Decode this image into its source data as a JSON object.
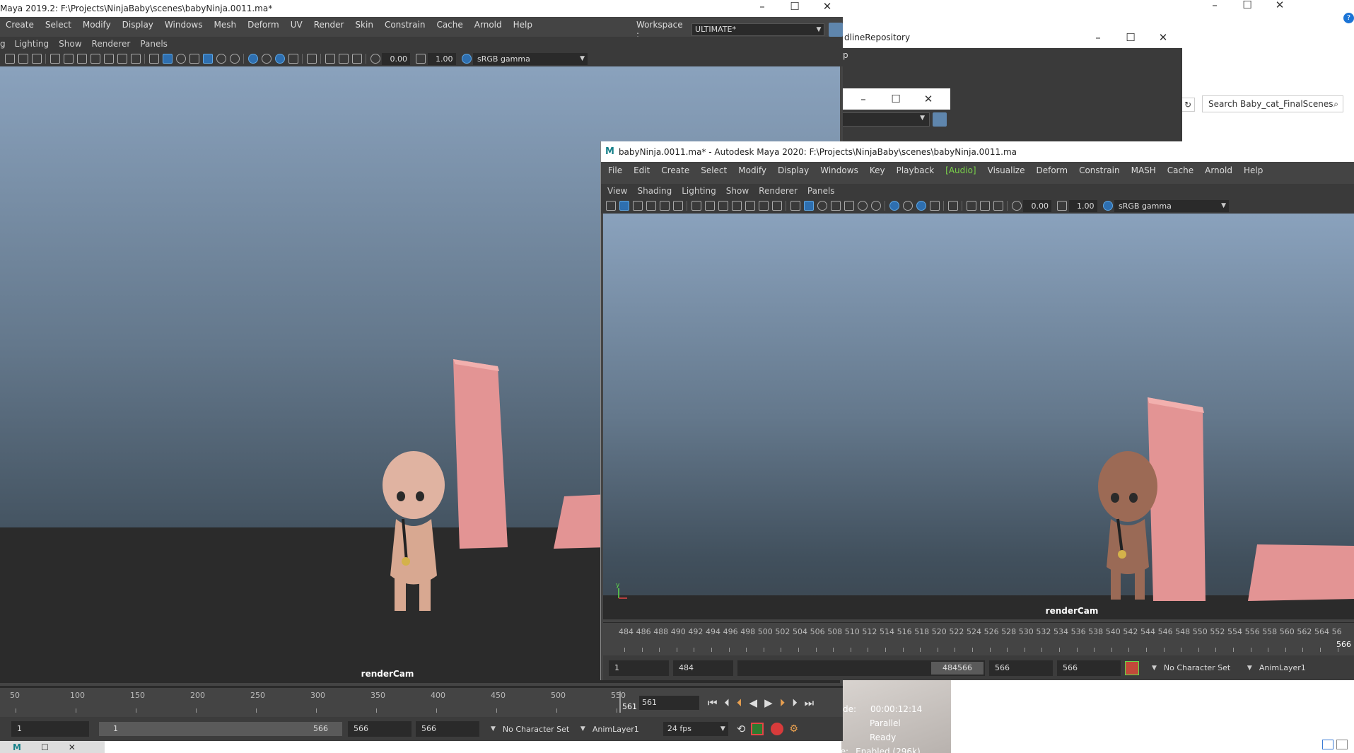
{
  "colors": {
    "accent": "#5fa7e3",
    "audio": "#7bd34a",
    "window_bg": "#444444",
    "sky_top": "#8aa2bd",
    "sky_bottom": "#41505d",
    "ground": "#2b2b2b",
    "pillar": "#e39494"
  },
  "window_a": {
    "title": "Maya 2019.2: F:\\Projects\\NinjaBaby\\scenes\\babyNinja.0011.ma*",
    "menus": [
      "Create",
      "Select",
      "Modify",
      "Display",
      "Windows",
      "Mesh",
      "Deform",
      "UV",
      "Render",
      "Skin",
      "Constrain",
      "Cache",
      "Arnold",
      "Help"
    ],
    "workspace_label": "Workspace :",
    "workspace_value": "ULTIMATE*",
    "panel_menus": [
      "Lighting",
      "Show",
      "Renderer",
      "Panels"
    ],
    "panel_menu_cut": "g",
    "exposure": "0.00",
    "gamma": "1.00",
    "colorspace": "sRGB gamma",
    "camera": "renderCam",
    "ticks": [
      "50",
      "100",
      "150",
      "200",
      "250",
      "300",
      "350",
      "400",
      "450",
      "500",
      "550"
    ],
    "current_frame": "561",
    "current_frame_field": "561",
    "range_start": "1",
    "slider_start": "1",
    "slider_end": "566",
    "range_end": "566",
    "range_end2": "566",
    "char_set": "No Character Set",
    "anim_layer": "AnimLayer1",
    "fps": "24 fps"
  },
  "window_b": {
    "title": "babyNinja.0011.ma* - Autodesk Maya 2020: F:\\Projects\\NinjaBaby\\scenes\\babyNinja.0011.ma",
    "menus": [
      "File",
      "Edit",
      "Create",
      "Select",
      "Modify",
      "Display",
      "Windows",
      "Key",
      "Playback",
      "[Audio]",
      "Visualize",
      "Deform",
      "Constrain",
      "MASH",
      "Cache",
      "Arnold",
      "Help"
    ],
    "panel_menus": [
      "View",
      "Shading",
      "Lighting",
      "Show",
      "Renderer",
      "Panels"
    ],
    "exposure": "0.00",
    "gamma": "1.00",
    "colorspace": "sRGB gamma",
    "camera": "renderCam",
    "ticks": [
      "484",
      "486",
      "488",
      "490",
      "492",
      "494",
      "496",
      "498",
      "500",
      "502",
      "504",
      "506",
      "508",
      "510",
      "512",
      "514",
      "516",
      "518",
      "520",
      "522",
      "524",
      "526",
      "528",
      "530",
      "532",
      "534",
      "536",
      "538",
      "540",
      "542",
      "544",
      "546",
      "548",
      "550",
      "552",
      "554",
      "556",
      "558",
      "560",
      "562",
      "564",
      "56"
    ],
    "current_frame": "566",
    "range_start": "1",
    "range_min": "484",
    "slider_label": "484566",
    "range_max": "566",
    "range_end": "566",
    "char_set": "No Character Set",
    "anim_layer": "AnimLayer1"
  },
  "bg_windows": {
    "repo_title": "dlineRepository",
    "repo_menu": "p",
    "search_placeholder": "Search Baby_cat_FinalScenes",
    "status": {
      "timecode_label": "de:",
      "timecode": "00:00:12:14",
      "mode": "Parallel",
      "state": "Ready",
      "gpu_label": "GPU Override:",
      "gpu_value": "Enabled (296k)"
    }
  }
}
